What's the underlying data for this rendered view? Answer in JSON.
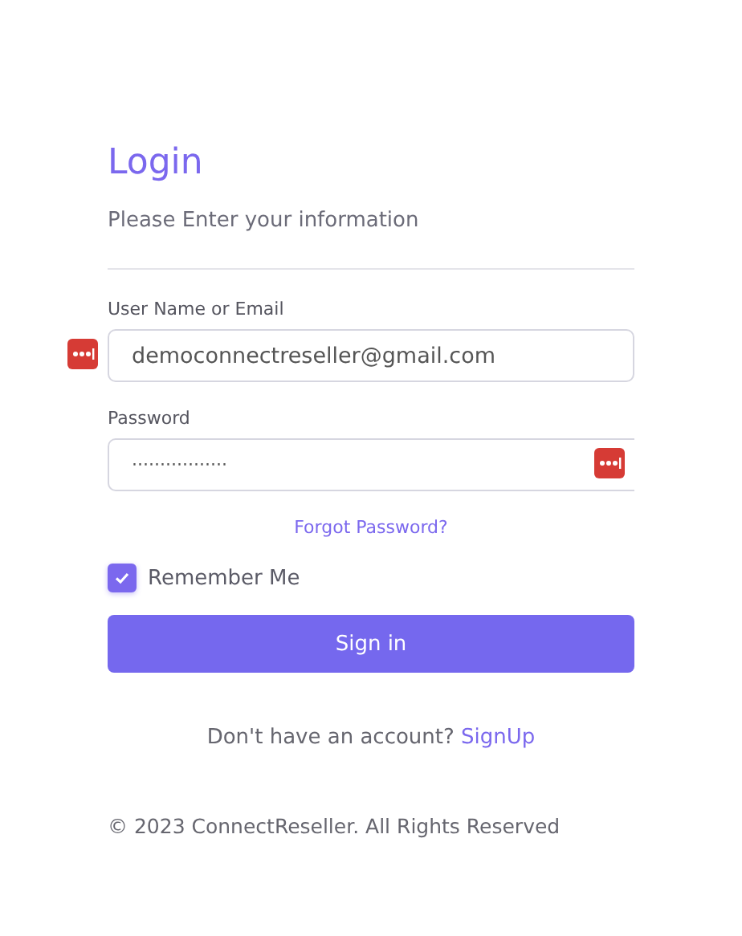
{
  "title": "Login",
  "subtitle": "Please Enter your information",
  "fields": [
    {
      "label": "User Name or Email",
      "value": "democonnectreseller@gmail.com",
      "kind": "text"
    },
    {
      "label": "Password",
      "value": "·················",
      "kind": "password"
    }
  ],
  "forgot_link": "Forgot Password?",
  "remember": {
    "label": "Remember Me",
    "checked": true
  },
  "submit": "Sign in",
  "signup": {
    "text": "Don't have an account?",
    "link": "SignUp"
  },
  "footer": "© 2023 ConnectReseller. All Rights Reserved"
}
